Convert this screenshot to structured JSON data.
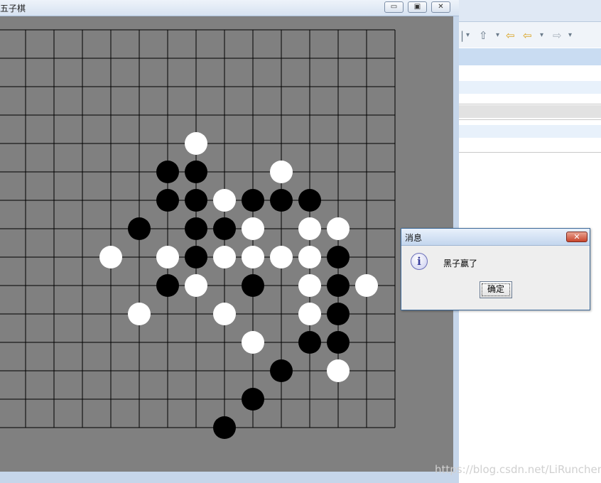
{
  "game_window": {
    "title": "五子棋",
    "buttons": {
      "minimize": "▭",
      "maximize": "▣",
      "close": "✕"
    }
  },
  "board": {
    "grid_lines": 15,
    "background_color": "#808080",
    "line_color": "#000000",
    "black_stones": [
      [
        6,
        5
      ],
      [
        7,
        5
      ],
      [
        6,
        6
      ],
      [
        7,
        6
      ],
      [
        9,
        6
      ],
      [
        10,
        6
      ],
      [
        11,
        6
      ],
      [
        5,
        7
      ],
      [
        7,
        7
      ],
      [
        8,
        7
      ],
      [
        7,
        8
      ],
      [
        12,
        8
      ],
      [
        6,
        9
      ],
      [
        9,
        9
      ],
      [
        12,
        9
      ],
      [
        12,
        10
      ],
      [
        11,
        11
      ],
      [
        12,
        11
      ],
      [
        10,
        12
      ],
      [
        9,
        13
      ],
      [
        8,
        14
      ]
    ],
    "white_stones": [
      [
        7,
        4
      ],
      [
        10,
        5
      ],
      [
        8,
        6
      ],
      [
        9,
        7
      ],
      [
        11,
        7
      ],
      [
        12,
        7
      ],
      [
        4,
        8
      ],
      [
        6,
        8
      ],
      [
        8,
        8
      ],
      [
        9,
        8
      ],
      [
        10,
        8
      ],
      [
        11,
        8
      ],
      [
        7,
        9
      ],
      [
        11,
        9
      ],
      [
        13,
        9
      ],
      [
        5,
        10
      ],
      [
        8,
        10
      ],
      [
        11,
        10
      ],
      [
        9,
        11
      ],
      [
        12,
        12
      ]
    ]
  },
  "dialog": {
    "title": "消息",
    "close_label": "✕",
    "icon": "info-icon",
    "icon_glyph": "i",
    "message": "黑子赢了",
    "ok_label": "确定"
  },
  "ide": {
    "toolbar_icons": [
      "▾",
      "⇧",
      "▾",
      "⇦",
      "⇦",
      "▾",
      "⇨",
      "▾"
    ]
  },
  "watermark": "https://blog.csdn.net/LiRunchen"
}
